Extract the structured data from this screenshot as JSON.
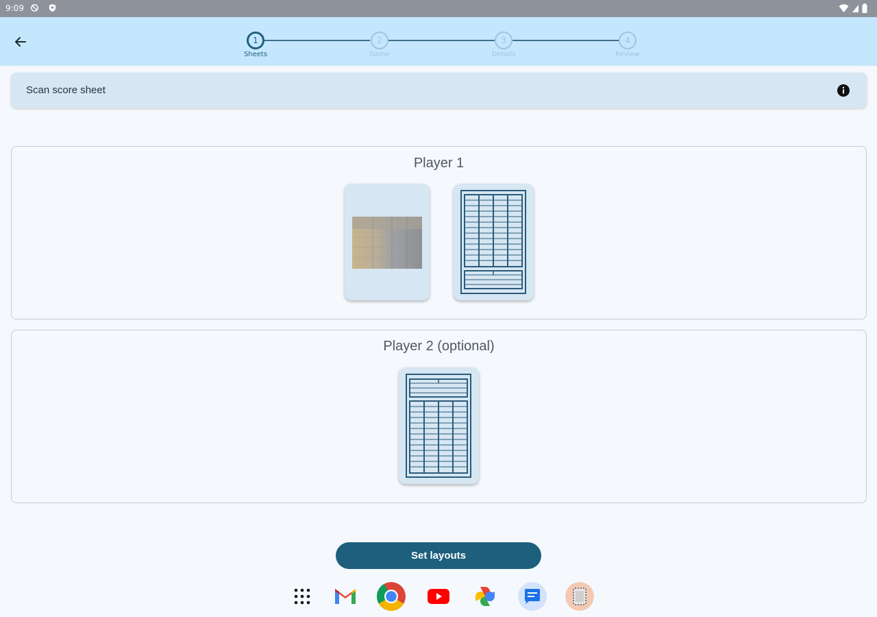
{
  "status_bar": {
    "time": "9:09",
    "left_icons": [
      "sync-disabled-icon",
      "shield-icon"
    ],
    "right_icons": [
      "wifi-icon",
      "signal-icon",
      "battery-icon"
    ]
  },
  "topbar": {
    "back_icon": "arrow-left-icon",
    "steps": [
      {
        "number": "1",
        "label": "Sheets",
        "active": true
      },
      {
        "number": "2",
        "label": "Game",
        "active": false
      },
      {
        "number": "3",
        "label": "Details",
        "active": false
      },
      {
        "number": "4",
        "label": "Review",
        "active": false
      }
    ]
  },
  "scan_card": {
    "title": "Scan score sheet",
    "info_icon": "info-icon"
  },
  "players": [
    {
      "title": "Player 1",
      "thumbnails": [
        "scanned-photo",
        "score-sheet-layout"
      ]
    },
    {
      "title": "Player 2 (optional)",
      "thumbnails": [
        "score-sheet-layout-inverted"
      ]
    }
  ],
  "actions": {
    "set_layouts_label": "Set layouts"
  },
  "dock": [
    "app-grid-icon",
    "gmail-icon",
    "chrome-icon",
    "youtube-icon",
    "photos-icon",
    "messages-icon",
    "app-icon"
  ],
  "colors": {
    "accent": "#1d5f7d",
    "topbar": "#c5e7fd",
    "card": "#d6e6f2",
    "background": "#f5f9fd"
  }
}
